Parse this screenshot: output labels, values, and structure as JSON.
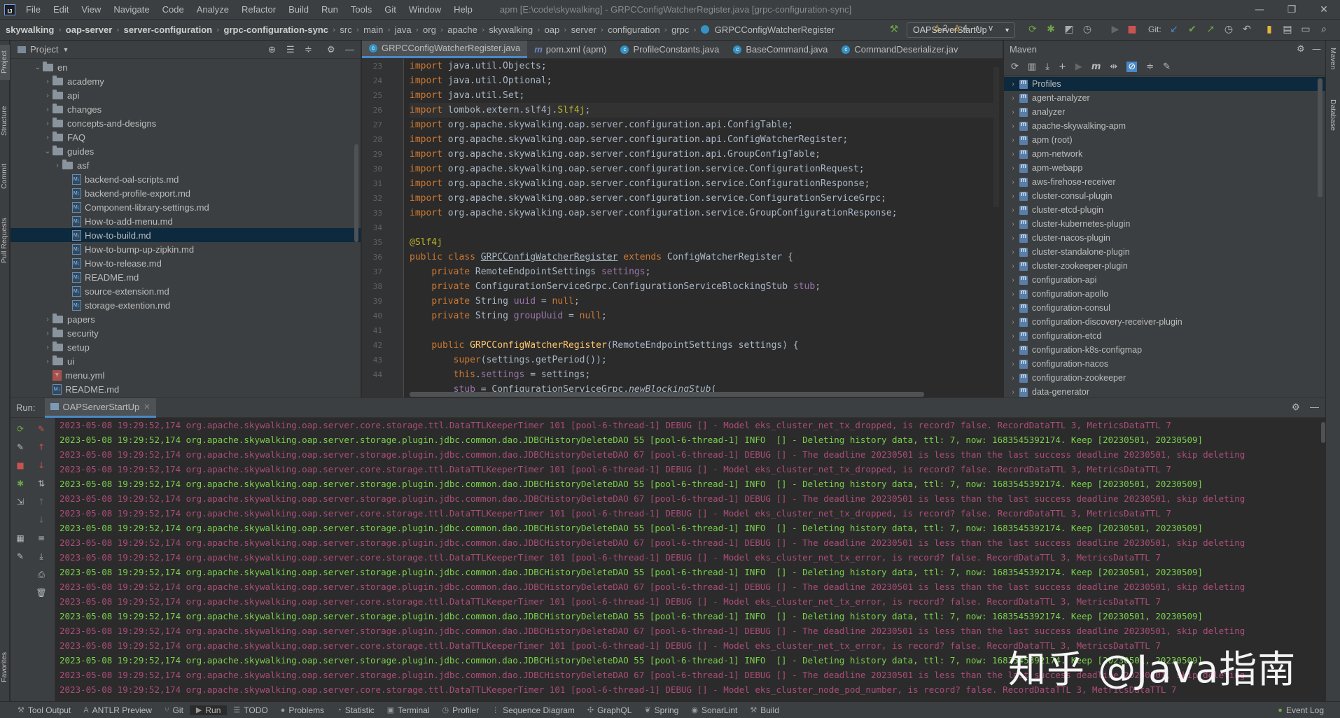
{
  "menubar": {
    "items": [
      "File",
      "Edit",
      "View",
      "Navigate",
      "Code",
      "Analyze",
      "Refactor",
      "Build",
      "Run",
      "Tools",
      "Git",
      "Window",
      "Help"
    ],
    "title": "apm [E:\\code\\skywalking] - GRPCConfigWatcherRegister.java [grpc-configuration-sync]"
  },
  "breadcrumb": {
    "items": [
      "skywalking",
      "oap-server",
      "server-configuration",
      "grpc-configuration-sync",
      "src",
      "main",
      "java",
      "org",
      "apache",
      "skywalking",
      "oap",
      "server",
      "configuration",
      "grpc",
      "GRPCConfigWatcherRegister"
    ]
  },
  "toolbar": {
    "run_config": "OAPServerStartUp",
    "git_label": "Git:"
  },
  "left_tools": [
    "Project",
    "Structure",
    "Commit",
    "Pull Requests",
    "Favorites"
  ],
  "right_tools": [
    "Maven",
    "Database"
  ],
  "project": {
    "title": "Project",
    "rows": [
      {
        "label": "en",
        "depth": 2,
        "type": "folder",
        "open": true
      },
      {
        "label": "academy",
        "depth": 3,
        "type": "folder"
      },
      {
        "label": "api",
        "depth": 3,
        "type": "folder"
      },
      {
        "label": "changes",
        "depth": 3,
        "type": "folder"
      },
      {
        "label": "concepts-and-designs",
        "depth": 3,
        "type": "folder"
      },
      {
        "label": "FAQ",
        "depth": 3,
        "type": "folder"
      },
      {
        "label": "guides",
        "depth": 3,
        "type": "folder",
        "open": true
      },
      {
        "label": "asf",
        "depth": 4,
        "type": "folder"
      },
      {
        "label": "backend-oal-scripts.md",
        "depth": 5,
        "type": "md"
      },
      {
        "label": "backend-profile-export.md",
        "depth": 5,
        "type": "md"
      },
      {
        "label": "Component-library-settings.md",
        "depth": 5,
        "type": "md"
      },
      {
        "label": "How-to-add-menu.md",
        "depth": 5,
        "type": "md"
      },
      {
        "label": "How-to-build.md",
        "depth": 5,
        "type": "md",
        "selected": true
      },
      {
        "label": "How-to-bump-up-zipkin.md",
        "depth": 5,
        "type": "md"
      },
      {
        "label": "How-to-release.md",
        "depth": 5,
        "type": "md"
      },
      {
        "label": "README.md",
        "depth": 5,
        "type": "md"
      },
      {
        "label": "source-extension.md",
        "depth": 5,
        "type": "md"
      },
      {
        "label": "storage-extention.md",
        "depth": 5,
        "type": "md"
      },
      {
        "label": "papers",
        "depth": 3,
        "type": "folder"
      },
      {
        "label": "security",
        "depth": 3,
        "type": "folder"
      },
      {
        "label": "setup",
        "depth": 3,
        "type": "folder"
      },
      {
        "label": "ui",
        "depth": 3,
        "type": "folder"
      },
      {
        "label": "menu.yml",
        "depth": 3,
        "type": "yml"
      },
      {
        "label": "README.md",
        "depth": 3,
        "type": "md"
      }
    ]
  },
  "tabs": [
    {
      "label": "GRPCConfigWatcherRegister.java",
      "icon": "class",
      "active": true
    },
    {
      "label": "pom.xml (apm)",
      "icon": "maven"
    },
    {
      "label": "ProfileConstants.java",
      "icon": "class"
    },
    {
      "label": "BaseCommand.java",
      "icon": "class"
    },
    {
      "label": "CommandDeserializer.jav",
      "icon": "class"
    }
  ],
  "inspections": {
    "warnings": "2",
    "weak": "4"
  },
  "editor": {
    "line_numbers": [
      "23",
      "24",
      "25",
      "26",
      "27",
      "28",
      "29",
      "30",
      "31",
      "32",
      "33",
      "34",
      "35",
      "36",
      "37",
      "38",
      "39",
      "40",
      "41",
      "42",
      "43",
      "44"
    ],
    "lines": [
      "<span class=\"kw\">import</span> java.util.Objects;",
      "<span class=\"kw\">import</span> java.util.Optional;",
      "<span class=\"kw\">import</span> java.util.Set;",
      "<span class=\"kw\">import</span> lombok.extern.slf4j.<span class=\"ann\">Slf4j</span>;",
      "<span class=\"kw\">import</span> org.apache.skywalking.oap.server.configuration.api.ConfigTable;",
      "<span class=\"kw\">import</span> org.apache.skywalking.oap.server.configuration.api.ConfigWatcherRegister;",
      "<span class=\"kw\">import</span> org.apache.skywalking.oap.server.configuration.api.GroupConfigTable;",
      "<span class=\"kw\">import</span> org.apache.skywalking.oap.server.configuration.service.ConfigurationRequest;",
      "<span class=\"kw\">import</span> org.apache.skywalking.oap.server.configuration.service.ConfigurationResponse;",
      "<span class=\"kw\">import</span> org.apache.skywalking.oap.server.configuration.service.ConfigurationServiceGrpc;",
      "<span class=\"kw\">import</span> org.apache.skywalking.oap.server.configuration.service.GroupConfigurationResponse;",
      "",
      "<span class=\"ann\">@Slf4j</span>",
      "<span class=\"kw\">public class</span> <span class=\"ul\">GRPCConfigWatcherRegister</span> <span class=\"kw\">extends</span> ConfigWatcherRegister {",
      "    <span class=\"kw\">private</span> RemoteEndpointSettings <span class=\"fld\">settings</span>;",
      "    <span class=\"kw\">private</span> ConfigurationServiceGrpc.ConfigurationServiceBlockingStub <span class=\"fld\">stub</span>;",
      "    <span class=\"kw\">private</span> String <span class=\"fld\">uuid</span> = <span class=\"kw\">null</span>;",
      "    <span class=\"kw\">private</span> String <span class=\"fld\">groupUuid</span> = <span class=\"kw\">null</span>;",
      "",
      "    <span class=\"kw\">public</span> <span class=\"fn\">GRPCConfigWatcherRegister</span>(RemoteEndpointSettings settings) {",
      "        <span class=\"kw\">super</span>(settings.getPeriod());",
      "        <span class=\"kw\">this</span>.<span class=\"fld\">settings</span> = settings;",
      "        <span class=\"fld\">stub</span> = ConfigurationServiceGrpc.<span class=\"it\">newBlockingStub</span>("
    ]
  },
  "maven": {
    "title": "Maven",
    "rows": [
      "Profiles",
      "agent-analyzer",
      "analyzer",
      "apache-skywalking-apm",
      "apm (root)",
      "apm-network",
      "apm-webapp",
      "aws-firehose-receiver",
      "cluster-consul-plugin",
      "cluster-etcd-plugin",
      "cluster-kubernetes-plugin",
      "cluster-nacos-plugin",
      "cluster-standalone-plugin",
      "cluster-zookeeper-plugin",
      "configuration-api",
      "configuration-apollo",
      "configuration-consul",
      "configuration-discovery-receiver-plugin",
      "configuration-etcd",
      "configuration-k8s-configmap",
      "configuration-nacos",
      "configuration-zookeeper",
      "data-generator"
    ]
  },
  "run": {
    "label": "Run:",
    "tab": "OAPServerStartUp",
    "lines": [
      {
        "level": "debug",
        "text": "2023-05-08 19:29:52,174 org.apache.skywalking.oap.server.core.storage.ttl.DataTTLKeeperTimer 101 [pool-6-thread-1] DEBUG [] - Model eks_cluster_net_tx_dropped, is record? false. RecordDataTTL 3, MetricsDataTTL 7"
      },
      {
        "level": "info",
        "text": "2023-05-08 19:29:52,174 org.apache.skywalking.oap.server.storage.plugin.jdbc.common.dao.JDBCHistoryDeleteDAO 55 [pool-6-thread-1] INFO  [] - Deleting history data, ttl: 7, now: 1683545392174. Keep [20230501, 20230509]"
      },
      {
        "level": "debug",
        "text": "2023-05-08 19:29:52,174 org.apache.skywalking.oap.server.storage.plugin.jdbc.common.dao.JDBCHistoryDeleteDAO 67 [pool-6-thread-1] DEBUG [] - The deadline 20230501 is less than the last success deadline 20230501, skip deleting"
      },
      {
        "level": "debug",
        "text": "2023-05-08 19:29:52,174 org.apache.skywalking.oap.server.core.storage.ttl.DataTTLKeeperTimer 101 [pool-6-thread-1] DEBUG [] - Model eks_cluster_net_tx_dropped, is record? false. RecordDataTTL 3, MetricsDataTTL 7"
      },
      {
        "level": "info",
        "text": "2023-05-08 19:29:52,174 org.apache.skywalking.oap.server.storage.plugin.jdbc.common.dao.JDBCHistoryDeleteDAO 55 [pool-6-thread-1] INFO  [] - Deleting history data, ttl: 7, now: 1683545392174. Keep [20230501, 20230509]"
      },
      {
        "level": "debug",
        "text": "2023-05-08 19:29:52,174 org.apache.skywalking.oap.server.storage.plugin.jdbc.common.dao.JDBCHistoryDeleteDAO 67 [pool-6-thread-1] DEBUG [] - The deadline 20230501 is less than the last success deadline 20230501, skip deleting"
      },
      {
        "level": "debug",
        "text": "2023-05-08 19:29:52,174 org.apache.skywalking.oap.server.core.storage.ttl.DataTTLKeeperTimer 101 [pool-6-thread-1] DEBUG [] - Model eks_cluster_net_tx_dropped, is record? false. RecordDataTTL 3, MetricsDataTTL 7"
      },
      {
        "level": "info",
        "text": "2023-05-08 19:29:52,174 org.apache.skywalking.oap.server.storage.plugin.jdbc.common.dao.JDBCHistoryDeleteDAO 55 [pool-6-thread-1] INFO  [] - Deleting history data, ttl: 7, now: 1683545392174. Keep [20230501, 20230509]"
      },
      {
        "level": "debug",
        "text": "2023-05-08 19:29:52,174 org.apache.skywalking.oap.server.storage.plugin.jdbc.common.dao.JDBCHistoryDeleteDAO 67 [pool-6-thread-1] DEBUG [] - The deadline 20230501 is less than the last success deadline 20230501, skip deleting"
      },
      {
        "level": "debug",
        "text": "2023-05-08 19:29:52,174 org.apache.skywalking.oap.server.core.storage.ttl.DataTTLKeeperTimer 101 [pool-6-thread-1] DEBUG [] - Model eks_cluster_net_tx_error, is record? false. RecordDataTTL 3, MetricsDataTTL 7"
      },
      {
        "level": "info",
        "text": "2023-05-08 19:29:52,174 org.apache.skywalking.oap.server.storage.plugin.jdbc.common.dao.JDBCHistoryDeleteDAO 55 [pool-6-thread-1] INFO  [] - Deleting history data, ttl: 7, now: 1683545392174. Keep [20230501, 20230509]"
      },
      {
        "level": "debug",
        "text": "2023-05-08 19:29:52,174 org.apache.skywalking.oap.server.storage.plugin.jdbc.common.dao.JDBCHistoryDeleteDAO 67 [pool-6-thread-1] DEBUG [] - The deadline 20230501 is less than the last success deadline 20230501, skip deleting"
      },
      {
        "level": "debug",
        "text": "2023-05-08 19:29:52,174 org.apache.skywalking.oap.server.core.storage.ttl.DataTTLKeeperTimer 101 [pool-6-thread-1] DEBUG [] - Model eks_cluster_net_tx_error, is record? false. RecordDataTTL 3, MetricsDataTTL 7"
      },
      {
        "level": "info",
        "text": "2023-05-08 19:29:52,174 org.apache.skywalking.oap.server.storage.plugin.jdbc.common.dao.JDBCHistoryDeleteDAO 55 [pool-6-thread-1] INFO  [] - Deleting history data, ttl: 7, now: 1683545392174. Keep [20230501, 20230509]"
      },
      {
        "level": "debug",
        "text": "2023-05-08 19:29:52,174 org.apache.skywalking.oap.server.storage.plugin.jdbc.common.dao.JDBCHistoryDeleteDAO 67 [pool-6-thread-1] DEBUG [] - The deadline 20230501 is less than the last success deadline 20230501, skip deleting"
      },
      {
        "level": "debug",
        "text": "2023-05-08 19:29:52,174 org.apache.skywalking.oap.server.core.storage.ttl.DataTTLKeeperTimer 101 [pool-6-thread-1] DEBUG [] - Model eks_cluster_net_tx_error, is record? false. RecordDataTTL 3, MetricsDataTTL 7"
      },
      {
        "level": "info",
        "text": "2023-05-08 19:29:52,174 org.apache.skywalking.oap.server.storage.plugin.jdbc.common.dao.JDBCHistoryDeleteDAO 55 [pool-6-thread-1] INFO  [] - Deleting history data, ttl: 7, now: 1683545392174. Keep [20230501, 20230509]"
      },
      {
        "level": "debug",
        "text": "2023-05-08 19:29:52,174 org.apache.skywalking.oap.server.storage.plugin.jdbc.common.dao.JDBCHistoryDeleteDAO 67 [pool-6-thread-1] DEBUG [] - The deadline 20230501 is less than the last success deadline 20230501, skip deleting"
      },
      {
        "level": "debug",
        "text": "2023-05-08 19:29:52,174 org.apache.skywalking.oap.server.core.storage.ttl.DataTTLKeeperTimer 101 [pool-6-thread-1] DEBUG [] - Model eks_cluster_node_pod_number, is record? false. RecordDataTTL 3, MetricsDataTTL 7"
      }
    ]
  },
  "watermark": "知乎 @Java指南",
  "bottom": {
    "items": [
      {
        "label": "Tool Output",
        "icon": "⚒"
      },
      {
        "label": "ANTLR Preview",
        "icon": "A"
      },
      {
        "label": "Git",
        "icon": "⑂"
      },
      {
        "label": "Run",
        "icon": "▶",
        "active": true
      },
      {
        "label": "TODO",
        "icon": "☰"
      },
      {
        "label": "Problems",
        "icon": "●"
      },
      {
        "label": "Statistic",
        "icon": "◔"
      },
      {
        "label": "Terminal",
        "icon": "▣"
      },
      {
        "label": "Profiler",
        "icon": "◷"
      },
      {
        "label": "Sequence Diagram",
        "icon": "⋮"
      },
      {
        "label": "GraphQL",
        "icon": "✣"
      },
      {
        "label": "Spring",
        "icon": "❦"
      },
      {
        "label": "SonarLint",
        "icon": "◉"
      },
      {
        "label": "Build",
        "icon": "⚒"
      }
    ],
    "event_log": "Event Log"
  },
  "colors": {
    "accent": "#4a88c7",
    "info": "#79d14b",
    "debug": "#ab4d78",
    "selection": "#0d293e"
  }
}
